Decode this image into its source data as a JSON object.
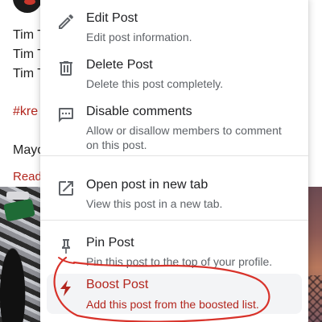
{
  "background_post": {
    "lines": [
      "Tim T",
      "Tim T",
      "Tim T",
      "#kre",
      "Mayo",
      "Read"
    ]
  },
  "menu": {
    "items": [
      {
        "icon": "pencil-icon",
        "title": "Edit Post",
        "description": "Edit post information."
      },
      {
        "icon": "trash-icon",
        "title": "Delete Post",
        "description": "Delete this post completely."
      },
      {
        "icon": "comment-dots-icon",
        "title": "Disable comments",
        "description": "Allow or disallow members to comment on this post."
      },
      {
        "icon": "open-external-icon",
        "title": "Open post in new tab",
        "description": "View this post in a new tab."
      },
      {
        "icon": "pin-icon",
        "title": "Pin Post",
        "description": "Pin this post to the top of your profile."
      },
      {
        "icon": "lightning-icon",
        "title": "Boost Post",
        "description": "Add this post from the boosted list."
      }
    ]
  },
  "colors": {
    "accent": "#b3261e",
    "highlight_bg": "#f3f4f6",
    "annotation": "#d8322a"
  }
}
